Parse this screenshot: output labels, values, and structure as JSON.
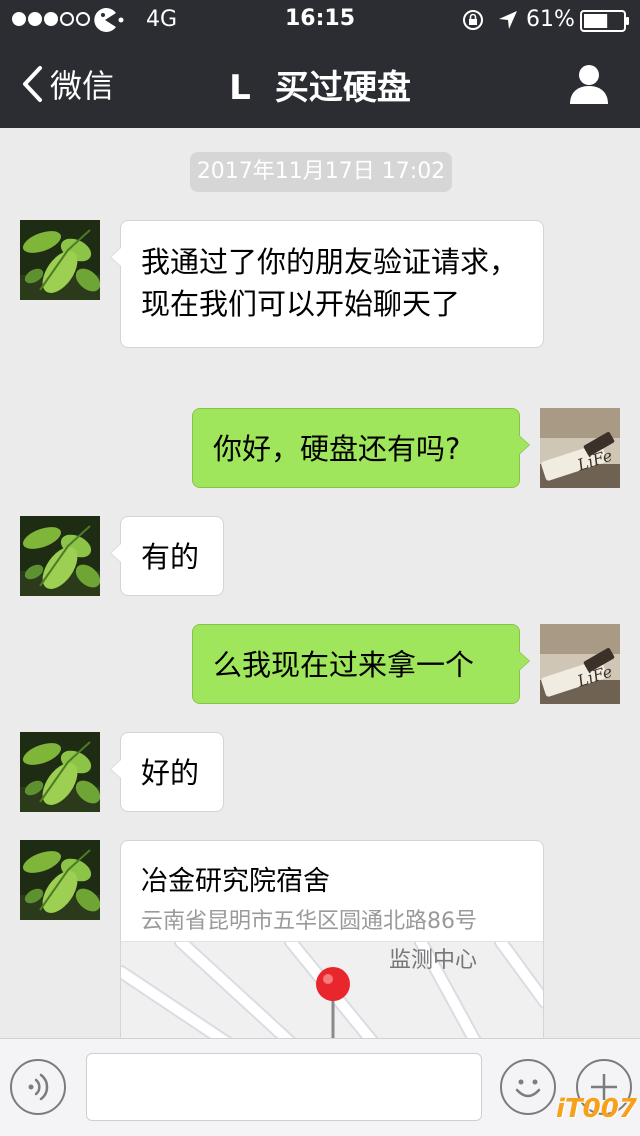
{
  "status_bar": {
    "signal_filled": 3,
    "signal_total": 5,
    "network": "4G",
    "time": "16:15",
    "battery_percent": "61%",
    "battery_level": 0.61,
    "icons": [
      "pacman-carrier-icon",
      "orientation-lock-icon",
      "location-arrow-icon",
      "battery-icon"
    ]
  },
  "nav": {
    "back_label": "微信",
    "title_initial": "L",
    "title": "买过硬盘",
    "profile_icon": "person-icon"
  },
  "chat": {
    "timestamp": "2017年11月17日 17:02",
    "messages": [
      {
        "from": "contact",
        "text": "我通过了你的朋友验证请求，现在我们可以开始聊天了"
      },
      {
        "from": "me",
        "text": "你好，硬盘还有吗?"
      },
      {
        "from": "contact",
        "text": "有的"
      },
      {
        "from": "me",
        "text": "么我现在过来拿一个"
      },
      {
        "from": "contact",
        "text": "好的"
      }
    ],
    "location": {
      "name": "冶金研究院宿舍",
      "address": "云南省昆明市五华区圆通北路86号",
      "map_label": "监测中心"
    }
  },
  "input_bar": {
    "message_value": "",
    "icons": [
      "voice-icon",
      "emoji-icon",
      "plus-icon"
    ]
  },
  "watermark": "iT007",
  "colors": {
    "nav_background": "#2b2d32",
    "chat_background": "#ebebeb",
    "outgoing_bubble": "#9fe65c",
    "incoming_bubble": "#ffffff",
    "timestamp_background": "#d6d6d6",
    "watermark": "#f7a11a"
  }
}
